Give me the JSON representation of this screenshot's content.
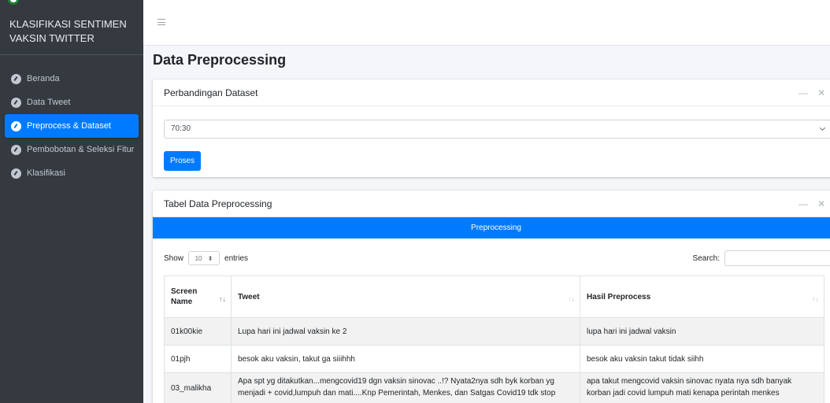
{
  "sidebar": {
    "brand": "KLASIFIKASI SENTIMEN VAKSIN TWITTER",
    "items": [
      {
        "label": "Beranda",
        "active": false
      },
      {
        "label": "Data Tweet",
        "active": false
      },
      {
        "label": "Preprocess & Dataset",
        "active": true
      },
      {
        "label": "Pembobotan & Seleksi Fitur",
        "active": false
      },
      {
        "label": "Klasifikasi",
        "active": false
      }
    ]
  },
  "page": {
    "title": "Data Preprocessing"
  },
  "card_dataset": {
    "title": "Perbandingan Dataset",
    "selected": "70:30",
    "button": "Proses"
  },
  "card_table": {
    "title": "Tabel Data Preprocessing",
    "bar_label": "Preprocessing",
    "show_label": "Show",
    "entries_value": "10",
    "entries_label": "entries",
    "search_label": "Search:",
    "columns": [
      "Screen Name",
      "Tweet",
      "Hasil Preprocess"
    ],
    "rows": [
      {
        "screen_name": "01k00kie",
        "tweet": "Lupa hari ini jadwal vaksin ke 2",
        "hasil": "lupa hari ini jadwal vaksin"
      },
      {
        "screen_name": "01pjh",
        "tweet": "besok aku vaksin, takut ga siiihhh",
        "hasil": "besok aku vaksin takut tidak siihh"
      },
      {
        "screen_name": "03_malikha",
        "tweet": "Apa spt yg ditakutkan...mengcovid19 dgn vaksin sinovac ..!? Nyata2nya sdh byk korban yg menjadi + covid,lumpuh dan mati....Knp Pemerintah, Menkes, dan Satgas Covid19 tdk stop",
        "hasil": "apa takut mengcovid vaksin sinovac nyata nya sdh banyak korban jadi covid lumpuh mati kenapa perintah menkes"
      }
    ]
  },
  "colors": {
    "primary": "#007bff",
    "sidebar_bg": "#343a40",
    "content_bg": "#f4f6f9"
  },
  "icons": {
    "nav": "dashboard-gauge-icon",
    "menu": "hamburger-icon",
    "minimize": "minus-icon",
    "close": "close-icon"
  }
}
